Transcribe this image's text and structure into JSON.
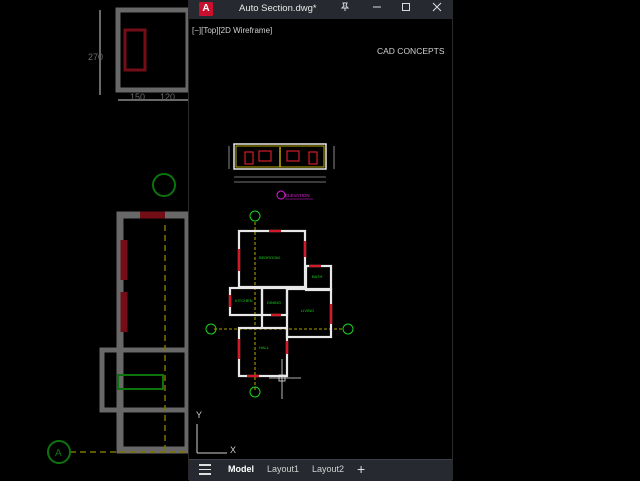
{
  "window": {
    "app_logo": "A",
    "title": "Auto Section.dwg*",
    "pin_icon": "pin-icon",
    "minimize_icon": "minimize-icon",
    "maximize_icon": "maximize-icon",
    "close_icon": "close-icon"
  },
  "viewport": {
    "label": "[−][Top][2D Wireframe]",
    "watermark": "CAD CONCEPTS",
    "ucs_y": "Y",
    "ucs_x": "X"
  },
  "drawing": {
    "elevation_label": "ELEVATION",
    "grid_marker_left": "A",
    "rooms": {
      "bedroom": "BEDROOM",
      "bath": "BATH",
      "kitchen": "KITCHEN",
      "dining": "DINING",
      "living": "LIVING",
      "hall": "HALL"
    },
    "dimension_values": [
      "150",
      "120",
      "270"
    ]
  },
  "tabs": {
    "menu_icon": "hamburger-menu-icon",
    "model": "Model",
    "layout1": "Layout1",
    "layout2": "Layout2",
    "add": "+"
  },
  "colors": {
    "wall": "#e8e8e8",
    "door_accent": "#d11a2a",
    "text_green": "#19d419",
    "grid_yellow": "#e6d400",
    "elevation_magenta": "#e020e0",
    "ui_bar": "#262a30"
  }
}
